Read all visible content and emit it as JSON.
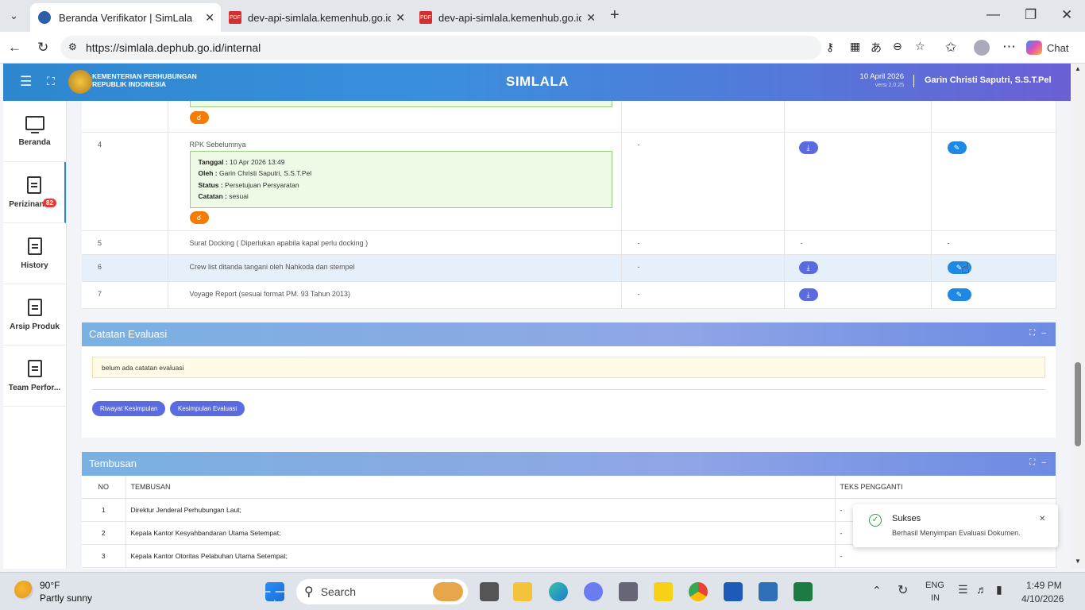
{
  "browser": {
    "tabs": [
      {
        "title": "Beranda Verifikator | SimLala",
        "active": true
      },
      {
        "title": "dev-api-simlala.kemenhub.go.id/a",
        "active": false
      },
      {
        "title": "dev-api-simlala.kemenhub.go.id/a",
        "active": false
      }
    ],
    "url": "https://simlala.dephub.go.id/internal",
    "chat_label": "Chat"
  },
  "header": {
    "org_line1": "KEMENTERIAN PERHUBUNGAN",
    "org_line2": "REPUBLIK INDONESIA",
    "app_name": "SIMLALA",
    "date": "10 April 2026",
    "version": "versi 2.0.25",
    "user": "Garin Christi Saputri, S.S.T.Pel"
  },
  "sidebar": {
    "items": [
      {
        "label": "Beranda"
      },
      {
        "label": "Perizinan",
        "badge": "82"
      },
      {
        "label": "History"
      },
      {
        "label": "Arsip Produk"
      },
      {
        "label": "Team Perfor..."
      }
    ]
  },
  "documents": {
    "rows": [
      {
        "no": "4",
        "name": "RPK Sebelumnya",
        "col3": "-",
        "history": {
          "tanggal_label": "Tanggal :",
          "tanggal": "10 Apr 2026 13:49",
          "oleh_label": "Oleh :",
          "oleh": "Garin Christi Saputri, S.S.T.Pel",
          "status_label": "Status :",
          "status": "Persetujuan Persyaratan",
          "catatan_label": "Catatan :",
          "catatan": "sesuai"
        }
      },
      {
        "no": "5",
        "name": "Surat Docking ( Diperlukan apabila kapal perlu docking )",
        "col3": "-",
        "col4": "-",
        "col5": "-"
      },
      {
        "no": "6",
        "name": "Crew list ditanda tangani oleh Nahkoda dan stempel",
        "col3": "-"
      },
      {
        "no": "7",
        "name": "Voyage Report (sesuai format PM. 93 Tahun 2013)",
        "col3": "-"
      }
    ]
  },
  "evaluasi": {
    "title": "Catatan Evaluasi",
    "empty_note": "belum ada catatan evaluasi",
    "btn_riwayat": "Riwayat Kesimpulan",
    "btn_kesimpulan": "Kesimpulan Evaluasi"
  },
  "tembusan": {
    "title": "Tembusan",
    "headers": [
      "NO",
      "TEMBUSAN",
      "TEKS PENGGANTI"
    ],
    "rows": [
      {
        "no": "1",
        "name": "Direktur Jenderal Perhubungan Laut;",
        "pengganti": "-"
      },
      {
        "no": "2",
        "name": "Kepala Kantor Kesyahbandaran Utama Setempat;",
        "pengganti": "-"
      },
      {
        "no": "3",
        "name": "Kepala Kantor Otoritas Pelabuhan Utama Setempat;",
        "pengganti": "-"
      }
    ]
  },
  "toast": {
    "title": "Sukses",
    "message": "Berhasil Menyimpan Evaluasi Dokumen."
  },
  "taskbar": {
    "weather_temp": "90°F",
    "weather_desc": "Partly sunny",
    "search_placeholder": "Search",
    "lang1": "ENG",
    "lang2": "IN",
    "time": "1:49 PM",
    "date": "4/10/2026"
  },
  "colors": {
    "accent": "#2d87cf",
    "button_purple": "#5a6be0",
    "button_blue": "#1e88e5",
    "button_orange": "#f57c00",
    "success": "#2e9d4a"
  }
}
